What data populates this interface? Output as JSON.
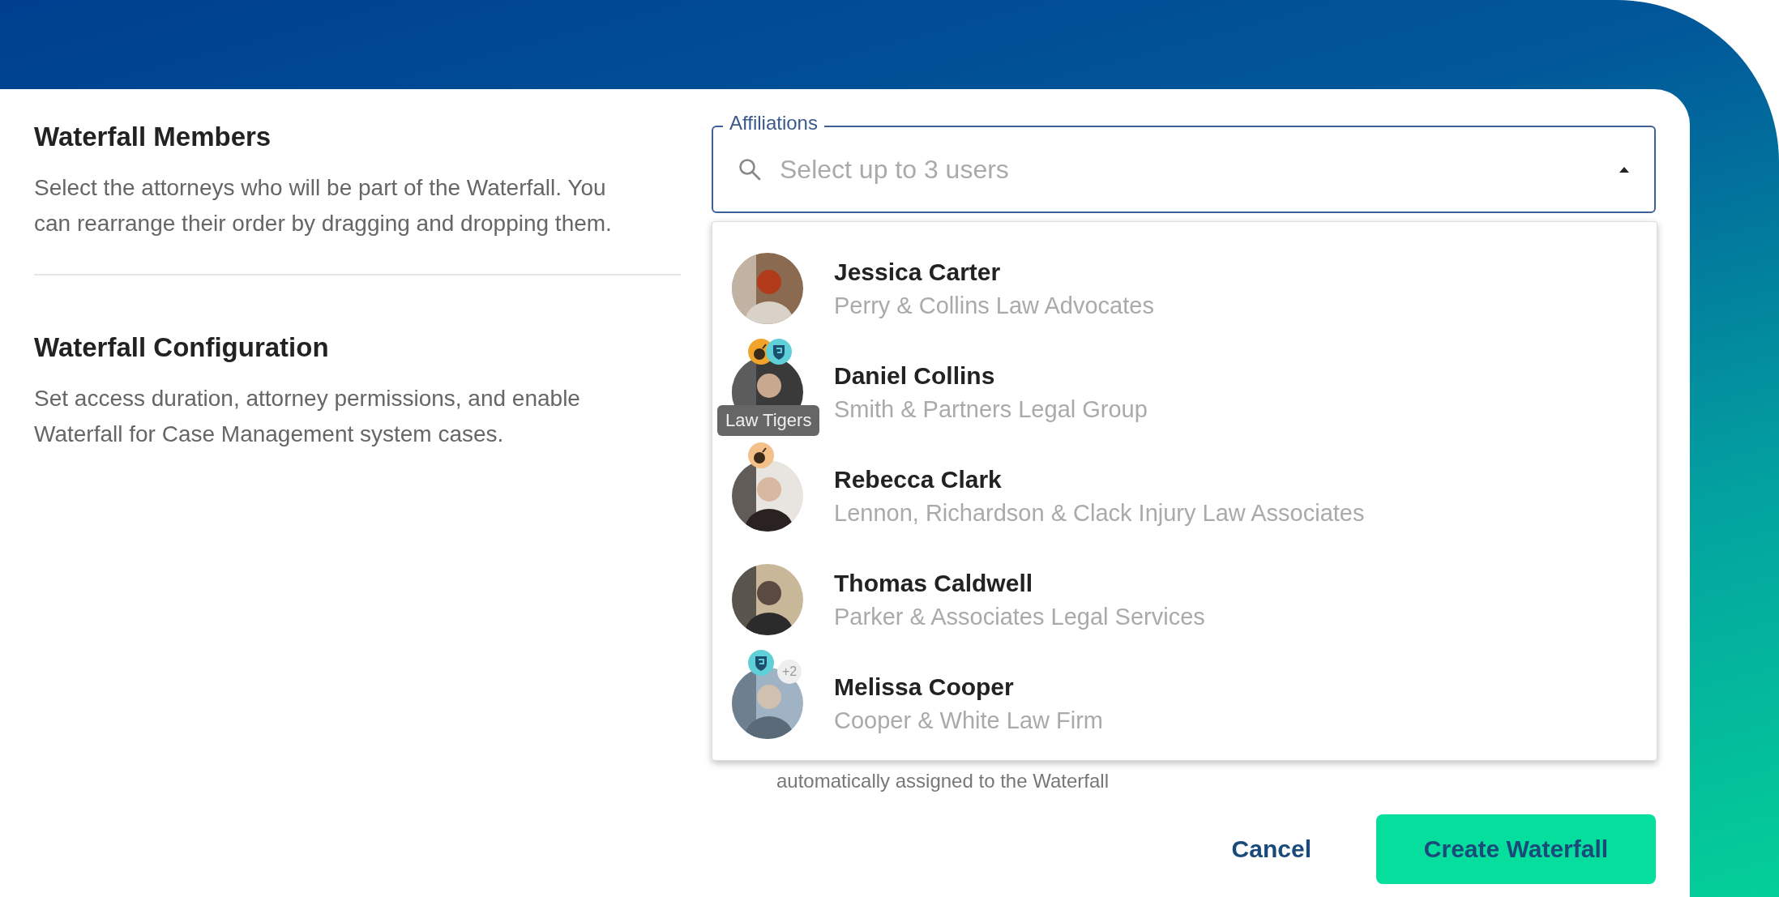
{
  "sections": [
    {
      "title": "Waterfall Members",
      "description": "Select the attorneys who will be part of the Waterfall. You can rearrange their order by dragging and dropping them."
    },
    {
      "title": "Waterfall Configuration",
      "description": "Set access duration, attorney permissions, and enable Waterfall for Case Management system cases."
    }
  ],
  "affiliations": {
    "label": "Affiliations",
    "placeholder": "Select up to 3 users",
    "expanded": true,
    "options": [
      {
        "name": "Jessica Carter",
        "company": "Perry & Collins Law Advocates"
      },
      {
        "name": "Daniel Collins",
        "company": "Smith & Partners Legal Group",
        "badges": [
          {
            "kind": "bomb",
            "color": "#f0a42a"
          },
          {
            "kind": "shield",
            "color": "#5fd0d8"
          }
        ],
        "tooltip": "Law Tigers"
      },
      {
        "name": "Rebecca Clark",
        "company": "Lennon, Richardson & Clack Injury Law Associates",
        "badges": [
          {
            "kind": "bomb",
            "color": "#f3c08a"
          }
        ]
      },
      {
        "name": "Thomas Caldwell",
        "company": "Parker & Associates Legal Services"
      },
      {
        "name": "Melissa Cooper",
        "company": "Cooper & White Law Firm",
        "badges": [
          {
            "kind": "shield",
            "color": "#5fd0d8"
          },
          {
            "kind": "count",
            "text": "+2"
          }
        ]
      }
    ]
  },
  "hint": "automatically assigned to the Waterfall",
  "buttons": [
    {
      "kind": "text",
      "label": "Cancel"
    },
    {
      "kind": "primary",
      "label": "Create Waterfall"
    }
  ]
}
